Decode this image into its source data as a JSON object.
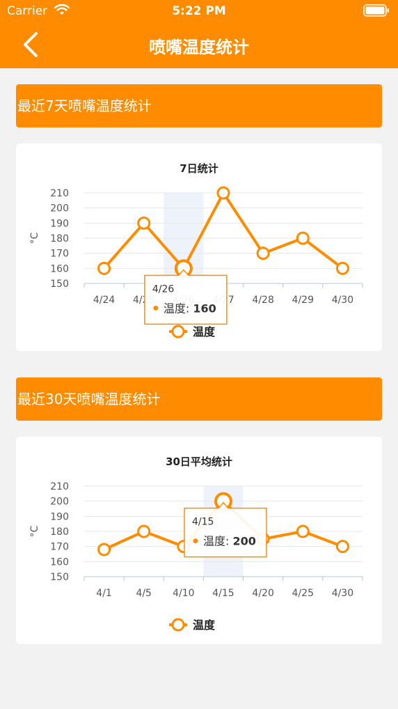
{
  "status_bar": {
    "carrier": "Carrier",
    "time": "5:22 PM"
  },
  "nav": {
    "title": "喷嘴温度统计",
    "back_icon": "chevron-left-icon"
  },
  "colors": {
    "accent": "#ff8c00",
    "background": "#f2f2f2",
    "card": "#ffffff"
  },
  "sections": [
    {
      "banner": "最近7天喷嘴温度统计"
    },
    {
      "banner": "最近30天喷嘴温度统计"
    }
  ],
  "chart_data": [
    {
      "type": "line",
      "title": "7日统计",
      "ylabel": "°C",
      "xlabel": "",
      "ylim": [
        150,
        210
      ],
      "yticks": [
        150,
        160,
        170,
        180,
        190,
        200,
        210
      ],
      "categories": [
        "4/24",
        "4/25",
        "4/26",
        "4/27",
        "4/28",
        "4/29",
        "4/30"
      ],
      "series": [
        {
          "name": "温度",
          "values": [
            160,
            190,
            160,
            210,
            170,
            180,
            160
          ]
        }
      ],
      "grid": true,
      "legend": "bottom-center",
      "tooltip": {
        "category": "4/26",
        "index": 2,
        "series_label": "温度",
        "separator": ": ",
        "value": "160"
      }
    },
    {
      "type": "line",
      "title": "30日平均统计",
      "ylabel": "°C",
      "xlabel": "",
      "ylim": [
        150,
        210
      ],
      "yticks": [
        150,
        160,
        170,
        180,
        190,
        200,
        210
      ],
      "categories": [
        "4/1",
        "4/5",
        "4/10",
        "4/15",
        "4/20",
        "4/25",
        "4/30"
      ],
      "series": [
        {
          "name": "温度",
          "values": [
            168,
            180,
            170,
            200,
            175,
            180,
            170
          ]
        }
      ],
      "grid": true,
      "legend": "bottom-center",
      "tooltip": {
        "category": "4/15",
        "index": 3,
        "series_label": "温度",
        "separator": ": ",
        "value": "200"
      }
    }
  ]
}
